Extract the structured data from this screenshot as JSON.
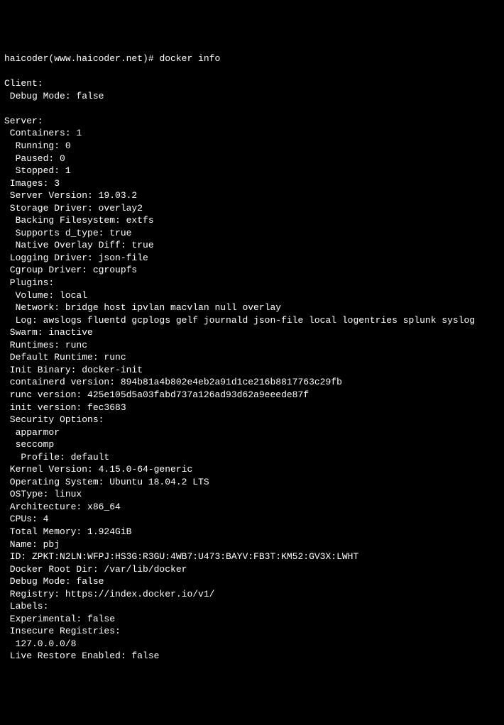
{
  "prompt": "haicoder(www.haicoder.net)# ",
  "command": "docker info",
  "lines": [
    "Client:",
    " Debug Mode: false",
    "",
    "Server:",
    " Containers: 1",
    "  Running: 0",
    "  Paused: 0",
    "  Stopped: 1",
    " Images: 3",
    " Server Version: 19.03.2",
    " Storage Driver: overlay2",
    "  Backing Filesystem: extfs",
    "  Supports d_type: true",
    "  Native Overlay Diff: true",
    " Logging Driver: json-file",
    " Cgroup Driver: cgroupfs",
    " Plugins:",
    "  Volume: local",
    "  Network: bridge host ipvlan macvlan null overlay",
    "  Log: awslogs fluentd gcplogs gelf journald json-file local logentries splunk syslog",
    " Swarm: inactive",
    " Runtimes: runc",
    " Default Runtime: runc",
    " Init Binary: docker-init",
    " containerd version: 894b81a4b802e4eb2a91d1ce216b8817763c29fb",
    " runc version: 425e105d5a03fabd737a126ad93d62a9eeede87f",
    " init version: fec3683",
    " Security Options:",
    "  apparmor",
    "  seccomp",
    "   Profile: default",
    " Kernel Version: 4.15.0-64-generic",
    " Operating System: Ubuntu 18.04.2 LTS",
    " OSType: linux",
    " Architecture: x86_64",
    " CPUs: 4",
    " Total Memory: 1.924GiB",
    " Name: pbj",
    " ID: ZPKT:N2LN:WFPJ:HS3G:R3GU:4WB7:U473:BAYV:FB3T:KM52:GV3X:LWHT",
    " Docker Root Dir: /var/lib/docker",
    " Debug Mode: false",
    " Registry: https://index.docker.io/v1/",
    " Labels:",
    " Experimental: false",
    " Insecure Registries:",
    "  127.0.0.0/8",
    " Live Restore Enabled: false"
  ]
}
